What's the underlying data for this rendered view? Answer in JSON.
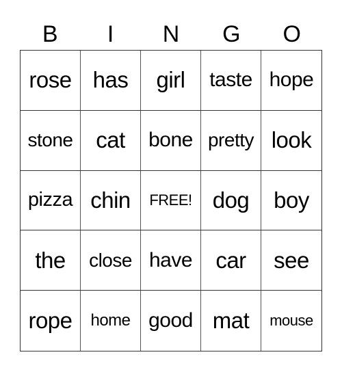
{
  "header": [
    "B",
    "I",
    "N",
    "G",
    "O"
  ],
  "cells": [
    [
      "rose",
      "has",
      "girl",
      "taste",
      "hope"
    ],
    [
      "stone",
      "cat",
      "bone",
      "pretty",
      "look"
    ],
    [
      "pizza",
      "chin",
      "FREE!",
      "dog",
      "boy"
    ],
    [
      "the",
      "close",
      "have",
      "car",
      "see"
    ],
    [
      "rope",
      "home",
      "good",
      "mat",
      "mouse"
    ]
  ]
}
